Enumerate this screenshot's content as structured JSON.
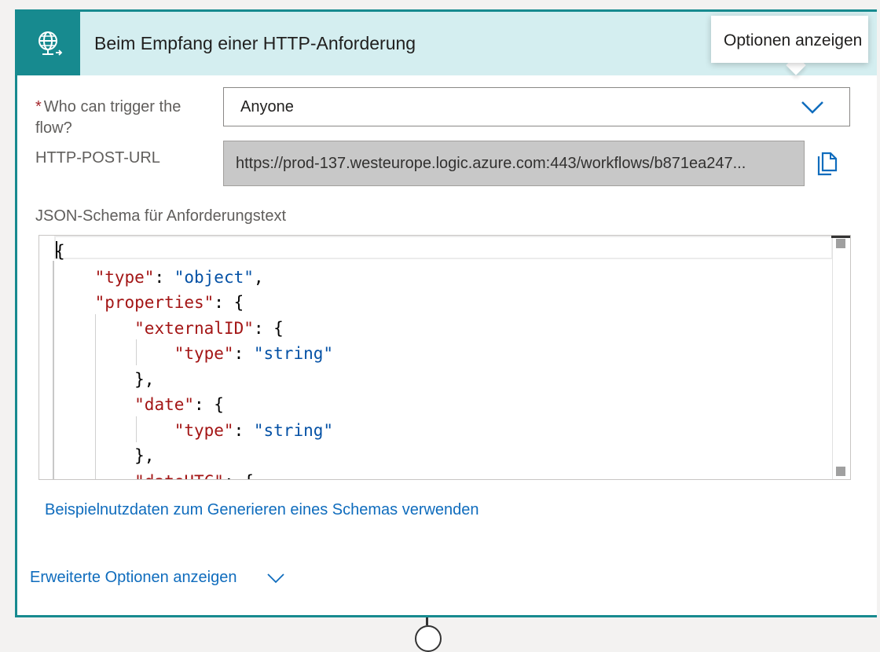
{
  "trigger": {
    "title": "Beim Empfang einer HTTP-Anforderung",
    "icon": "globe-network-icon",
    "accent_color": "#178a8f",
    "header_bg": "#d4eef0"
  },
  "tooltip": {
    "text": "Optionen anzeigen"
  },
  "fields": {
    "who_can_trigger": {
      "required_mark": "*",
      "label": "Who can trigger the flow?",
      "value": "Anyone"
    },
    "http_post_url": {
      "label": "HTTP-POST-URL",
      "value": "https://prod-137.westeurope.logic.azure.com:443/workflows/b871ea247..."
    },
    "json_schema": {
      "label": "JSON-Schema für Anforderungstext"
    }
  },
  "editor": {
    "lines": [
      [
        {
          "t": "p",
          "v": "{"
        }
      ],
      [
        {
          "t": "p",
          "v": "    "
        },
        {
          "t": "k",
          "v": "\"type\""
        },
        {
          "t": "p",
          "v": ": "
        },
        {
          "t": "s",
          "v": "\"object\""
        },
        {
          "t": "p",
          "v": ","
        }
      ],
      [
        {
          "t": "p",
          "v": "    "
        },
        {
          "t": "k",
          "v": "\"properties\""
        },
        {
          "t": "p",
          "v": ": {"
        }
      ],
      [
        {
          "t": "p",
          "v": "        "
        },
        {
          "t": "k",
          "v": "\"externalID\""
        },
        {
          "t": "p",
          "v": ": {"
        }
      ],
      [
        {
          "t": "p",
          "v": "            "
        },
        {
          "t": "k",
          "v": "\"type\""
        },
        {
          "t": "p",
          "v": ": "
        },
        {
          "t": "s",
          "v": "\"string\""
        }
      ],
      [
        {
          "t": "p",
          "v": "        },"
        }
      ],
      [
        {
          "t": "p",
          "v": "        "
        },
        {
          "t": "k",
          "v": "\"date\""
        },
        {
          "t": "p",
          "v": ": {"
        }
      ],
      [
        {
          "t": "p",
          "v": "            "
        },
        {
          "t": "k",
          "v": "\"type\""
        },
        {
          "t": "p",
          "v": ": "
        },
        {
          "t": "s",
          "v": "\"string\""
        }
      ],
      [
        {
          "t": "p",
          "v": "        },"
        }
      ],
      [
        {
          "t": "p",
          "v": "        "
        },
        {
          "t": "k",
          "v": "\"dateUTC\""
        },
        {
          "t": "p",
          "v": ": {"
        }
      ]
    ]
  },
  "links": {
    "sample_payload": "Beispielnutzdaten zum Generieren eines Schemas verwenden",
    "advanced_options": "Erweiterte Optionen anzeigen"
  }
}
